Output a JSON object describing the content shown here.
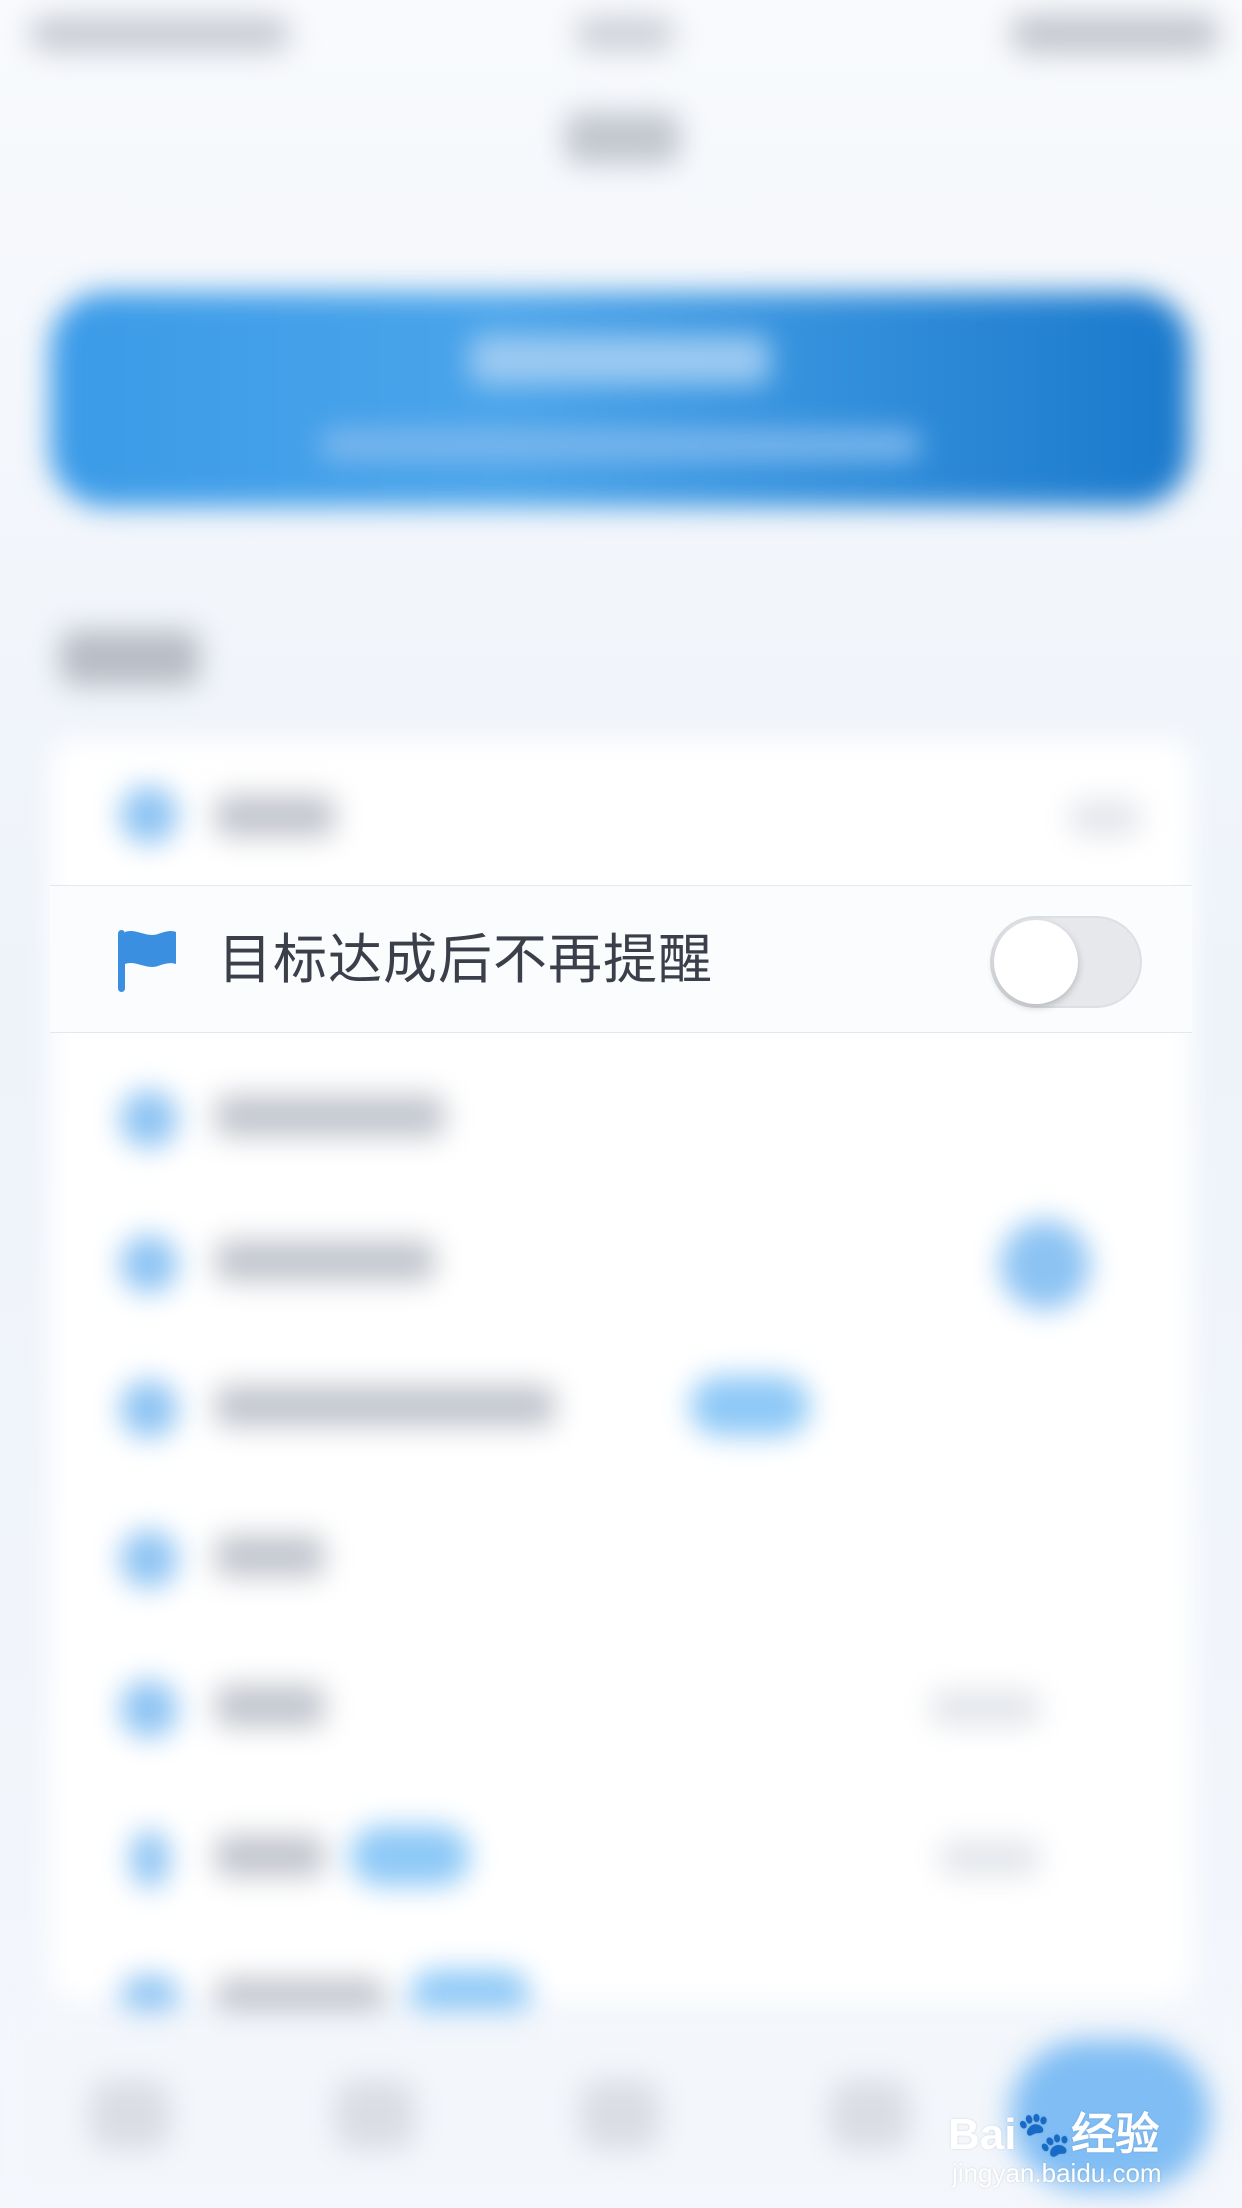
{
  "settings_row": {
    "label": "目标达成后不再提醒",
    "icon": "flag-icon",
    "toggle_on": false,
    "icon_color": "#3b8fe0"
  },
  "watermark": {
    "logo_text": "Bai🐾经验",
    "url": "jingyan.baidu.com"
  },
  "colors": {
    "accent": "#3b9be8",
    "banner_dark": "#1a79cc",
    "label_text": "#3a3f4a"
  }
}
